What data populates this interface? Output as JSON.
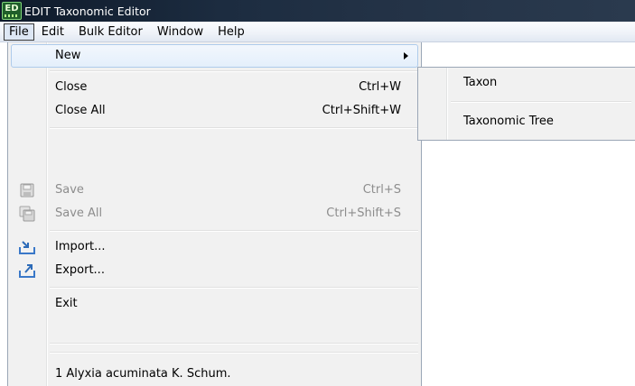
{
  "window": {
    "title": "EDIT Taxonomic Editor",
    "icon": "edit-app-icon",
    "icon_text": "ED"
  },
  "menubar": {
    "items": [
      "File",
      "Edit",
      "Bulk Editor",
      "Window",
      "Help"
    ],
    "active": "File"
  },
  "file_menu": {
    "new": {
      "label": "New",
      "has_submenu": true
    },
    "close": {
      "label": "Close",
      "shortcut": "Ctrl+W"
    },
    "close_all": {
      "label": "Close All",
      "shortcut": "Ctrl+Shift+W"
    },
    "save": {
      "label": "Save",
      "shortcut": "Ctrl+S",
      "disabled": true,
      "icon": "save-icon"
    },
    "save_all": {
      "label": "Save All",
      "shortcut": "Ctrl+Shift+S",
      "disabled": true,
      "icon": "save-all-icon"
    },
    "import": {
      "label": "Import...",
      "icon": "import-icon"
    },
    "export": {
      "label": "Export...",
      "icon": "export-icon"
    },
    "exit": {
      "label": "Exit"
    },
    "recent_1": {
      "label": "1 Alyxia acuminata K. Schum."
    }
  },
  "new_submenu": {
    "items": [
      "Taxon",
      "Taxonomic Tree"
    ]
  },
  "colors": {
    "highlight_border": "#aecbeb",
    "menu_bg": "#f1f1f1",
    "titlebar": "#1c2c40"
  }
}
